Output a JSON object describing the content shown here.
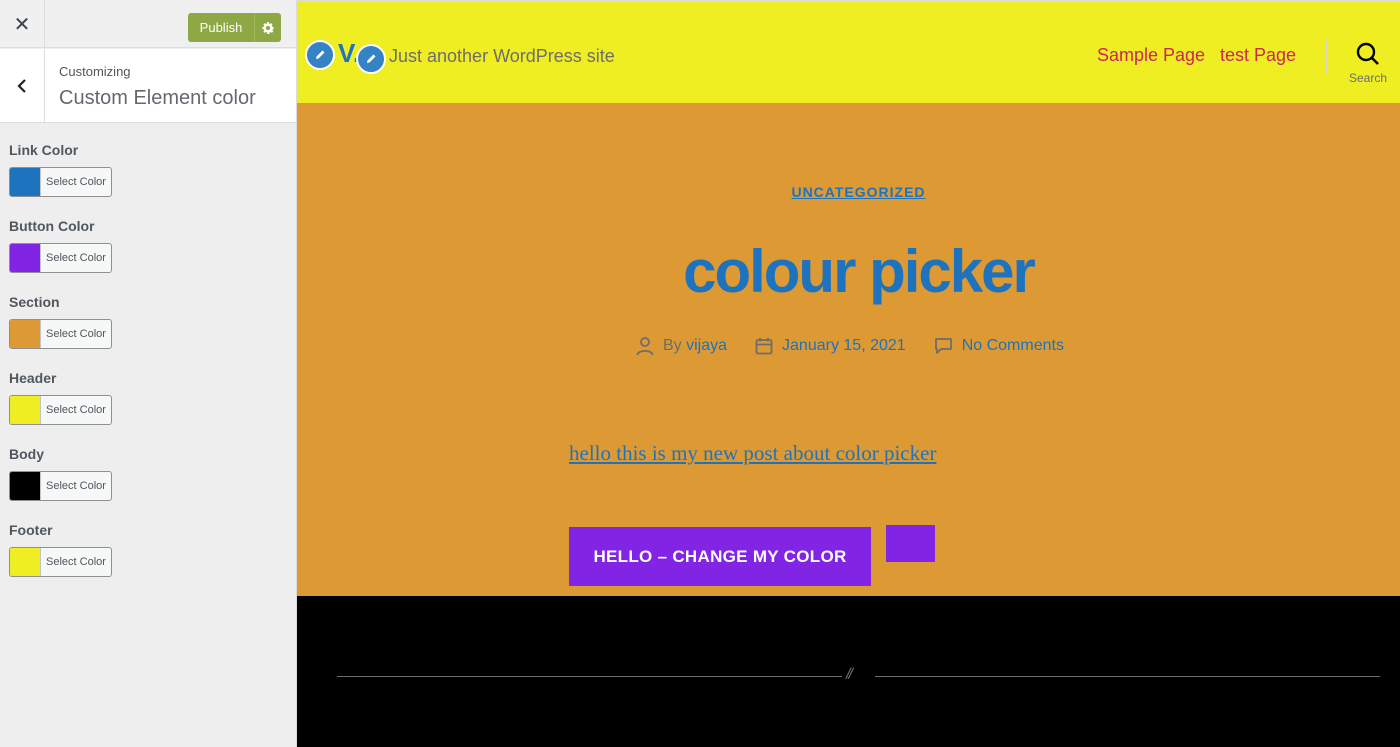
{
  "customizer": {
    "close_glyph": "✕",
    "publish_label": "Publish",
    "customizing_label": "Customizing",
    "section_title": "Custom Element color",
    "controls": [
      {
        "label": "Link Color",
        "button_text": "Select Color",
        "color": "#1e73be"
      },
      {
        "label": "Button Color",
        "button_text": "Select Color",
        "color": "#8224e3"
      },
      {
        "label": "Section",
        "button_text": "Select Color",
        "color": "#dd9933"
      },
      {
        "label": "Header",
        "button_text": "Select Color",
        "color": "#eeee22"
      },
      {
        "label": "Body",
        "button_text": "Select Color",
        "color": "#000000"
      },
      {
        "label": "Footer",
        "button_text": "Select Color",
        "color": "#eeee22"
      }
    ]
  },
  "site": {
    "title": "V.",
    "description": "Just another WordPress site",
    "nav": [
      "Sample Page",
      "test Page"
    ],
    "search_label": "Search",
    "colors": {
      "header": "#eeee22",
      "section": "#dd9933",
      "link": "#1e73be",
      "button": "#8224e3",
      "footer": "#000000",
      "nav_link": "#cd2653"
    }
  },
  "post": {
    "category": "UNCATEGORIZED",
    "title": "colour picker",
    "author_prefix": "By",
    "author": "vijaya",
    "date": "January 15, 2021",
    "comments": "No Comments",
    "content": "hello this is my new post about color picker",
    "button_label": "HELLO – CHANGE MY COLOR"
  },
  "footer": {
    "separator": "//"
  }
}
